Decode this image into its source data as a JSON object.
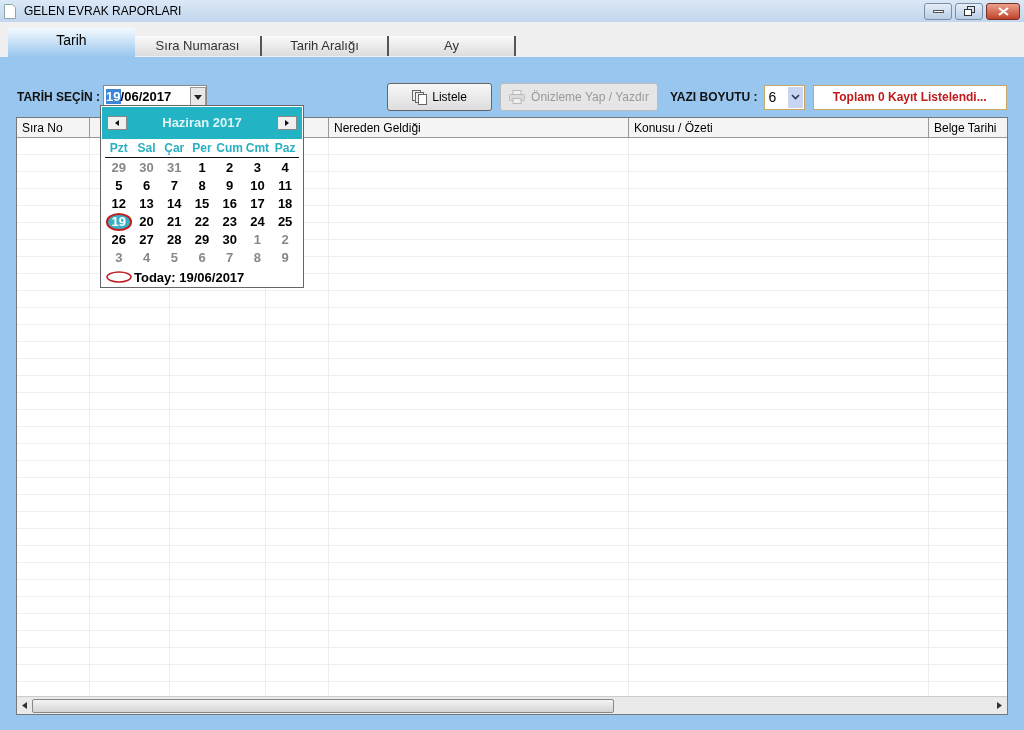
{
  "window": {
    "title": "GELEN EVRAK RAPORLARI"
  },
  "tabs": [
    {
      "label": "Tarih",
      "selected": true
    },
    {
      "label": "Sıra Numarası",
      "selected": false
    },
    {
      "label": "Tarih Aralığı",
      "selected": false
    },
    {
      "label": "Ay",
      "selected": false
    }
  ],
  "date_picker": {
    "label": "TARİH SEÇİN :",
    "day": "19",
    "rest": "/06/2017",
    "calendar": {
      "month": "Haziran 2017",
      "weekdays": [
        "Pzt",
        "Sal",
        "Çar",
        "Per",
        "Cum",
        "Cmt",
        "Paz"
      ],
      "weeks": [
        [
          {
            "text": "29",
            "muted": true,
            "selected": false
          },
          {
            "text": "30",
            "muted": true,
            "selected": false
          },
          {
            "text": "31",
            "muted": true,
            "selected": false
          },
          {
            "text": "1",
            "muted": false,
            "selected": false
          },
          {
            "text": "2",
            "muted": false,
            "selected": false
          },
          {
            "text": "3",
            "muted": false,
            "selected": false
          },
          {
            "text": "4",
            "muted": false,
            "selected": false
          }
        ],
        [
          {
            "text": "5",
            "muted": false,
            "selected": false
          },
          {
            "text": "6",
            "muted": false,
            "selected": false
          },
          {
            "text": "7",
            "muted": false,
            "selected": false
          },
          {
            "text": "8",
            "muted": false,
            "selected": false
          },
          {
            "text": "9",
            "muted": false,
            "selected": false
          },
          {
            "text": "10",
            "muted": false,
            "selected": false
          },
          {
            "text": "11",
            "muted": false,
            "selected": false
          }
        ],
        [
          {
            "text": "12",
            "muted": false,
            "selected": false
          },
          {
            "text": "13",
            "muted": false,
            "selected": false
          },
          {
            "text": "14",
            "muted": false,
            "selected": false
          },
          {
            "text": "15",
            "muted": false,
            "selected": false
          },
          {
            "text": "16",
            "muted": false,
            "selected": false
          },
          {
            "text": "17",
            "muted": false,
            "selected": false
          },
          {
            "text": "18",
            "muted": false,
            "selected": false
          }
        ],
        [
          {
            "text": "19",
            "muted": false,
            "selected": true
          },
          {
            "text": "20",
            "muted": false,
            "selected": false
          },
          {
            "text": "21",
            "muted": false,
            "selected": false
          },
          {
            "text": "22",
            "muted": false,
            "selected": false
          },
          {
            "text": "23",
            "muted": false,
            "selected": false
          },
          {
            "text": "24",
            "muted": false,
            "selected": false
          },
          {
            "text": "25",
            "muted": false,
            "selected": false
          }
        ],
        [
          {
            "text": "26",
            "muted": false,
            "selected": false
          },
          {
            "text": "27",
            "muted": false,
            "selected": false
          },
          {
            "text": "28",
            "muted": false,
            "selected": false
          },
          {
            "text": "29",
            "muted": false,
            "selected": false
          },
          {
            "text": "30",
            "muted": false,
            "selected": false
          },
          {
            "text": "1",
            "muted": true,
            "selected": false
          },
          {
            "text": "2",
            "muted": true,
            "selected": false
          }
        ],
        [
          {
            "text": "3",
            "muted": true,
            "selected": false
          },
          {
            "text": "4",
            "muted": true,
            "selected": false
          },
          {
            "text": "5",
            "muted": true,
            "selected": false
          },
          {
            "text": "6",
            "muted": true,
            "selected": false
          },
          {
            "text": "7",
            "muted": true,
            "selected": false
          },
          {
            "text": "8",
            "muted": true,
            "selected": false
          },
          {
            "text": "9",
            "muted": true,
            "selected": false
          }
        ]
      ],
      "today": "Today: 19/06/2017"
    }
  },
  "buttons": [
    {
      "label": "Listele",
      "disabled": false
    },
    {
      "label": "Önizleme Yap / Yazdır",
      "disabled": true
    }
  ],
  "font_size": {
    "label": "YAZI BOYUTU :",
    "value": "6"
  },
  "status": "Toplam 0 Kayıt Listelendi...",
  "table": {
    "columns": [
      {
        "label": "Sıra No"
      },
      {
        "label": "Nereden Geldiği"
      },
      {
        "label": "Konusu / Özeti"
      },
      {
        "label": "Belge Tarihi"
      }
    ]
  }
}
